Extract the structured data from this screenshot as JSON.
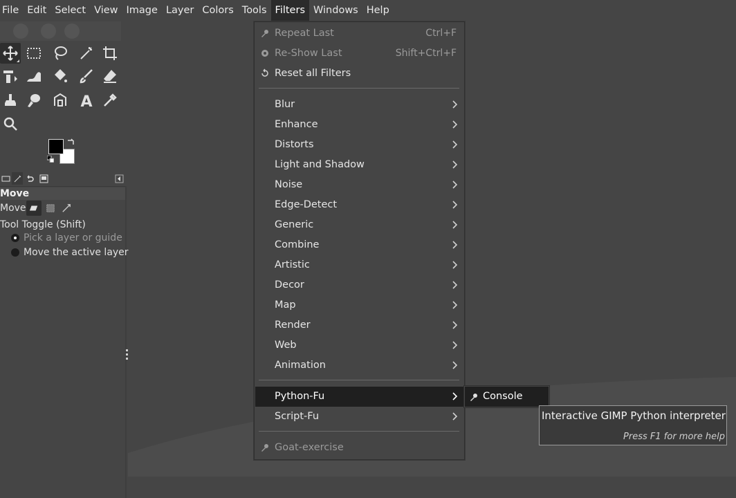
{
  "menubar": {
    "items": [
      {
        "label": "File"
      },
      {
        "label": "Edit"
      },
      {
        "label": "Select"
      },
      {
        "label": "View"
      },
      {
        "label": "Image"
      },
      {
        "label": "Layer"
      },
      {
        "label": "Colors"
      },
      {
        "label": "Tools"
      },
      {
        "label": "Filters",
        "active": true
      },
      {
        "label": "Windows"
      },
      {
        "label": "Help"
      }
    ]
  },
  "tool_options": {
    "title": "Move",
    "move_label": "Move:",
    "toggle_label": "Tool Toggle  (Shift)",
    "options": [
      {
        "label": "Pick a layer or guide",
        "selected": true
      },
      {
        "label": "Move the active layer",
        "selected": false
      }
    ]
  },
  "filters_menu": {
    "repeat_last": {
      "label": "Repeat Last",
      "accel": "Ctrl+F"
    },
    "reshow_last": {
      "label": "Re-Show Last",
      "accel": "Shift+Ctrl+F"
    },
    "reset_all": {
      "label": "Reset all Filters"
    },
    "categories": [
      {
        "label": "Blur"
      },
      {
        "label": "Enhance"
      },
      {
        "label": "Distorts"
      },
      {
        "label": "Light and Shadow"
      },
      {
        "label": "Noise"
      },
      {
        "label": "Edge-Detect"
      },
      {
        "label": "Generic"
      },
      {
        "label": "Combine"
      },
      {
        "label": "Artistic"
      },
      {
        "label": "Decor"
      },
      {
        "label": "Map"
      },
      {
        "label": "Render"
      },
      {
        "label": "Web"
      },
      {
        "label": "Animation"
      }
    ],
    "python_fu": {
      "label": "Python-Fu"
    },
    "script_fu": {
      "label": "Script-Fu"
    },
    "goat": {
      "label": "Goat-exercise"
    }
  },
  "submenu": {
    "console_label": "Console"
  },
  "tooltip": {
    "text": "Interactive GIMP Python interpreter",
    "hint": "Press F1 for more help"
  },
  "colors": {
    "accent_bg": "#1f1f1f",
    "panel": "#454545"
  }
}
